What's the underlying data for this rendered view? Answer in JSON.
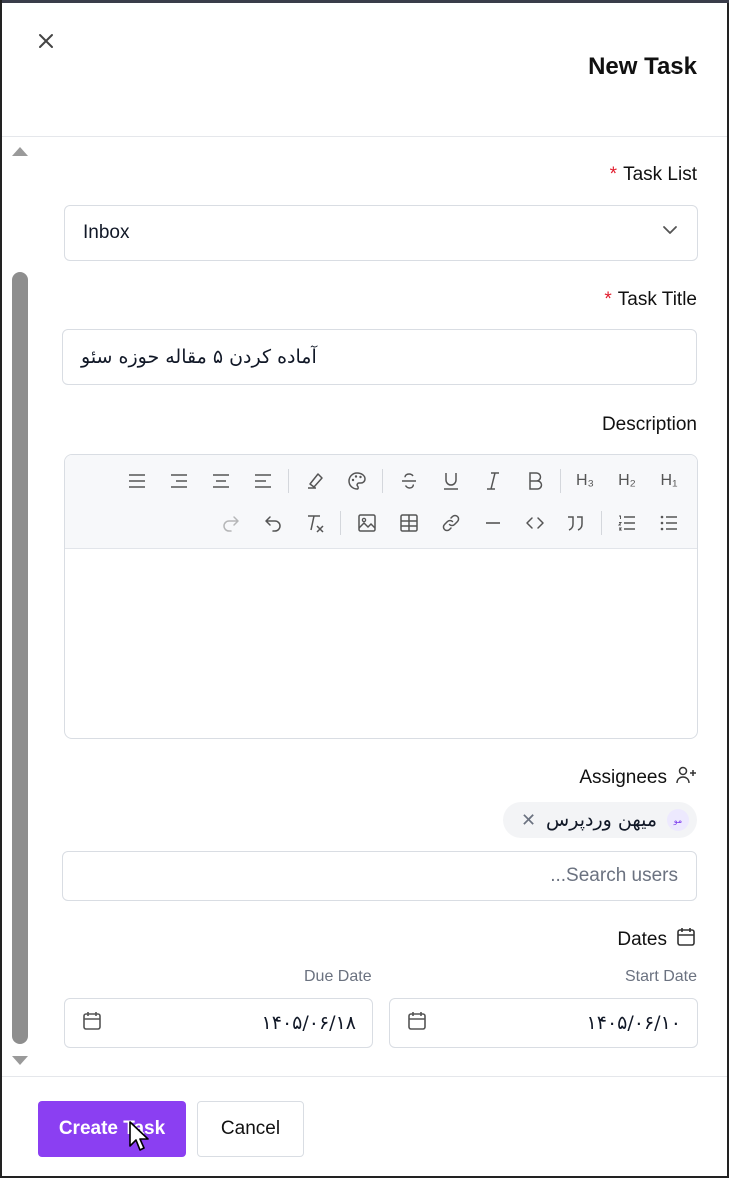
{
  "header": {
    "title": "New Task"
  },
  "task_list": {
    "label": "Task List",
    "required_mark": "*",
    "value": "Inbox"
  },
  "task_title": {
    "label": "Task Title",
    "required_mark": "*",
    "value": "آماده کردن ۵ مقاله حوزه سئو"
  },
  "description": {
    "label": "Description",
    "toolbar": [
      "align-justify",
      "align-right",
      "align-center",
      "align-left",
      "highlight",
      "color-palette",
      "strikethrough",
      "underline",
      "italic",
      "bold",
      "heading-3",
      "heading-2",
      "heading-1",
      "redo",
      "undo",
      "clear-format",
      "image",
      "table",
      "link",
      "horizontal-rule",
      "code",
      "blockquote",
      "ordered-list",
      "bullet-list"
    ],
    "heading_labels": {
      "h3": "H₃",
      "h2": "H₂",
      "h1": "H₁"
    }
  },
  "assignees": {
    "label": "Assignees",
    "selected": [
      {
        "name": "میهن وردپرس",
        "initials": "مو"
      }
    ],
    "search_placeholder": "...Search users"
  },
  "dates": {
    "label": "Dates",
    "due_date": {
      "label": "Due Date",
      "value": "۱۴۰۵/۰۶/۱۸"
    },
    "start_date": {
      "label": "Start Date",
      "value": "۱۴۰۵/۰۶/۱۰"
    }
  },
  "footer": {
    "create_label": "Create Task",
    "cancel_label": "Cancel"
  },
  "colors": {
    "primary": "#8b3ff2",
    "required": "#e11d2e"
  }
}
